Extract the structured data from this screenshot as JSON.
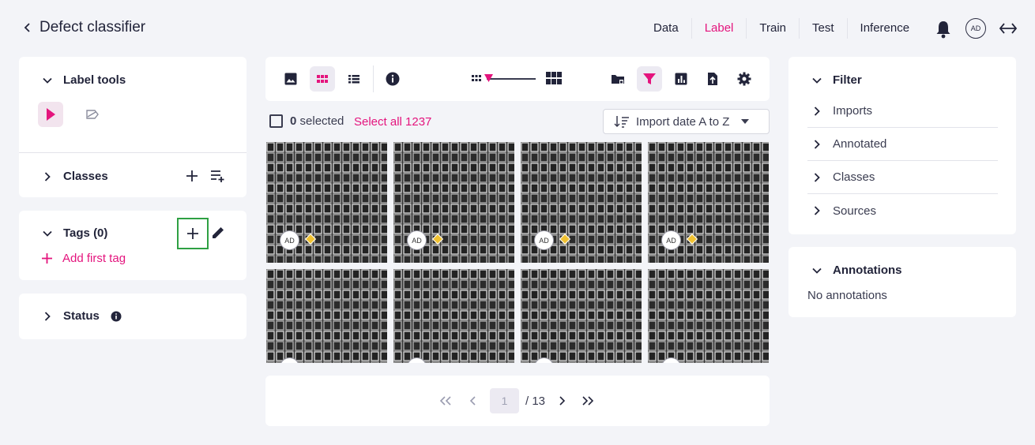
{
  "header": {
    "back_title": "Defect classifier",
    "nav_tabs": [
      {
        "label": "Data",
        "active": false
      },
      {
        "label": "Label",
        "active": true
      },
      {
        "label": "Train",
        "active": false
      },
      {
        "label": "Test",
        "active": false
      },
      {
        "label": "Inference",
        "active": false
      }
    ],
    "avatar_initials": "AD",
    "accent_color": "#e4147d"
  },
  "left": {
    "label_tools": {
      "title": "Label tools",
      "tools": [
        "pointer-icon",
        "ring-icon"
      ]
    },
    "classes": {
      "title": "Classes"
    },
    "tags": {
      "title": "Tags (0)",
      "add_first": "Add first tag"
    },
    "status": {
      "title": "Status"
    }
  },
  "center": {
    "toolbar_icons": [
      "image-view-icon",
      "grid-view-icon",
      "list-view-icon",
      "info-icon",
      "folder-lock-icon",
      "filter-icon",
      "chart-icon",
      "export-icon",
      "settings-icon"
    ],
    "selection": {
      "count": "0",
      "selected_text": "selected",
      "select_all": "Select all 1237"
    },
    "sort": {
      "label": "Import date A to Z"
    },
    "thumbnails": [
      {
        "initials": "AD"
      },
      {
        "initials": "AD"
      },
      {
        "initials": "AD"
      },
      {
        "initials": "AD"
      },
      {
        "initials": ""
      },
      {
        "initials": ""
      },
      {
        "initials": ""
      },
      {
        "initials": ""
      }
    ],
    "pagination": {
      "current": "1",
      "total": "/ 13"
    }
  },
  "right": {
    "filter": {
      "title": "Filter",
      "items": [
        "Imports",
        "Annotated",
        "Classes",
        "Sources"
      ]
    },
    "annotations": {
      "title": "Annotations",
      "empty": "No annotations"
    }
  }
}
